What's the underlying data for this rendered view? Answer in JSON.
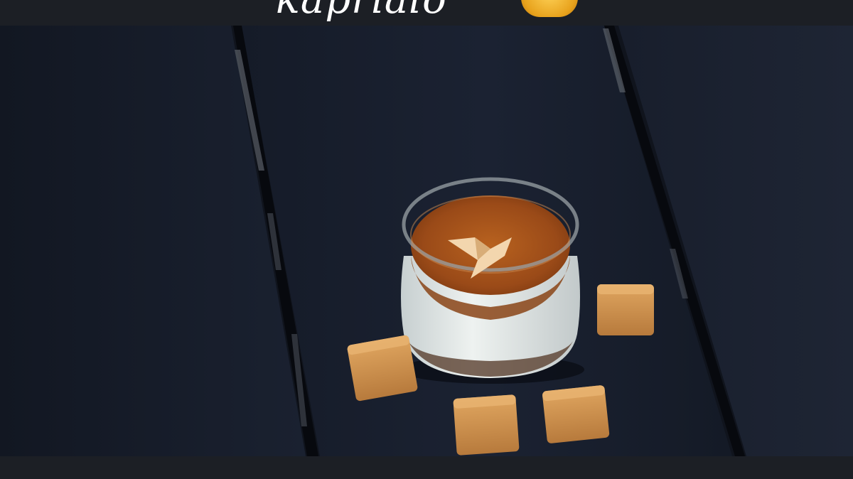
{
  "caption": {
    "text": "kaprialo",
    "emoji": "grinning-face-emoji"
  },
  "scene": {
    "description_items": [
      "dessert-jar",
      "caramel-cubes",
      "wooden-planks"
    ],
    "colors": {
      "wood": "#141a26",
      "caramel_sauce": "#a8541c",
      "cream": "#dde3e2",
      "caramel_cube": "#d1914e"
    }
  }
}
